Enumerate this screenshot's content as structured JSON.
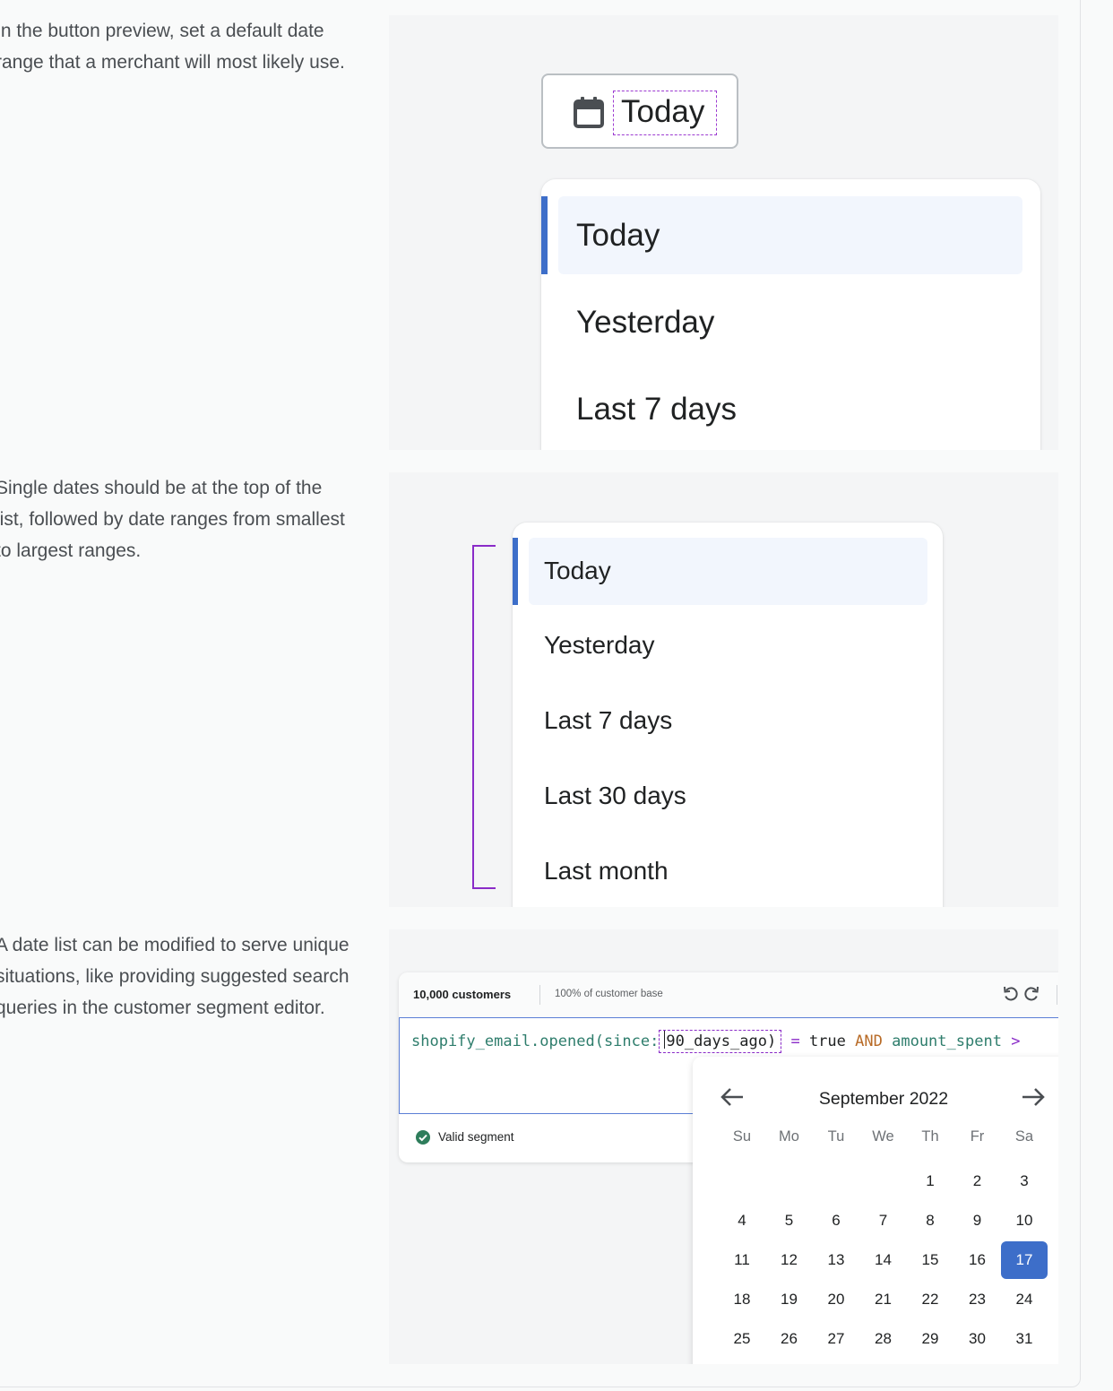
{
  "sections": [
    {
      "description": "In the button preview, set a default date range that a merchant will most likely use.",
      "button_label": "Today",
      "list": [
        "Today",
        "Yesterday",
        "Last 7 days"
      ],
      "selected_index": 0
    },
    {
      "description": "Single dates should be at the top of the list, followed by date ranges from smallest to largest ranges.",
      "list": [
        "Today",
        "Yesterday",
        "Last 7 days",
        "Last 30 days",
        "Last month"
      ],
      "selected_index": 0
    },
    {
      "description": "A date list can be modified to serve unique situations, like providing suggested search queries in the customer segment editor.",
      "segment": {
        "count": "10,000 customers",
        "base": "100% of customer base",
        "code": {
          "fn": "shopify_email.opened(",
          "param": "since:",
          "arg": "90_days_ago)",
          "eq": "=",
          "val": "true",
          "and": "AND",
          "field": "amount_spent",
          "gt": ">"
        },
        "status": "Valid segment"
      },
      "calendar": {
        "month": "September 2022",
        "weekdays": [
          "Su",
          "Mo",
          "Tu",
          "We",
          "Th",
          "Fr",
          "Sa"
        ],
        "first_weekday": 4,
        "days_in_month": 31,
        "selected_day": 17
      }
    }
  ],
  "colors": {
    "accent": "#3d6ec9",
    "selection_bg": "#f2f6fd",
    "annotation": "#8a2bc8"
  }
}
